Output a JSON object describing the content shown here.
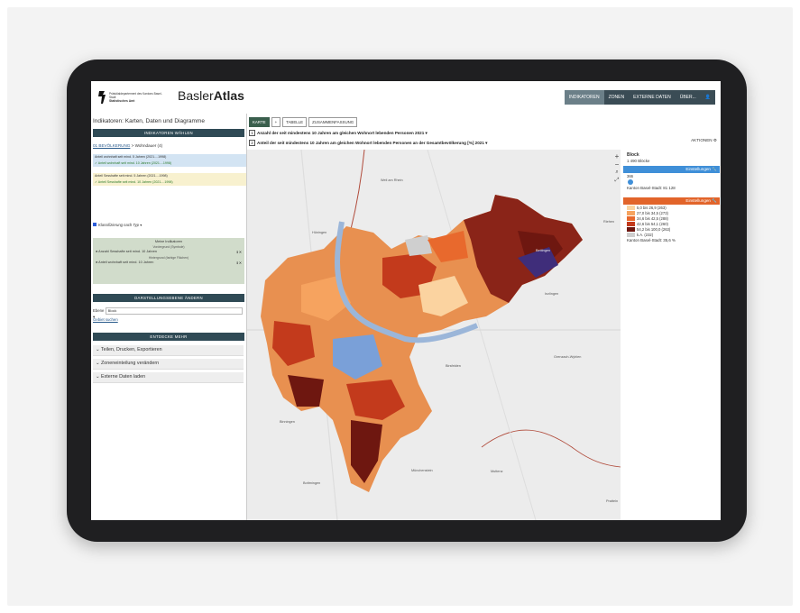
{
  "header": {
    "dept_line1": "Präsidialdepartement des Kantons Basel-Stadt",
    "dept_line2": "Statistisches Amt",
    "brand_light": "Basler",
    "brand_bold": "Atlas",
    "nav": [
      "INDIKATOREN",
      "ZONEN",
      "EXTERNE DATEN",
      "ÜBER...",
      "👤"
    ]
  },
  "left": {
    "title": "Indikatoren: Karten, Daten und Diagramme",
    "bar_indicators": "INDIKATOREN WÄHLEN",
    "crumb_link": "01 BEVÖLKERUNG",
    "crumb_rest": " > Wohndauer (4)",
    "indicators": [
      "Anteil wohnhaft seit mind. 5 Jahren (2021....1998)",
      "✓ Anteil wohnhaft seit mind. 10 Jahren (2021....1998)",
      "Anteil Sesshafte seit mind. 5 Jahren (2021....1998)",
      "✓ Anteil Sesshafte seit mind. 10 Jahren (2021....1998)"
    ],
    "checkbox_label": "Klassifizierung nach Typ",
    "my_indicators": {
      "title": "Meine Indikatoren",
      "sub1": "Vordergrund (Symbole)",
      "row1": "Anzahl Sesshafte seit mind. 10 Jahren",
      "sub2": "Hintergrund (farbige Flächen)",
      "row2": "Anteil wohnhaft seit mind. 10 Jahren"
    },
    "bar_display": "DARSTELLUNGSEBENE ÄNDERN",
    "level_label": "Ebene",
    "level_value": "Block",
    "search_link": "Gebiet suchen",
    "bar_discover": "ENTDECKE MEHR",
    "accordions": [
      "Teilen, Drucken, Exportieren",
      "Zoneneinteilung verändern",
      "Externe Daten laden"
    ]
  },
  "main": {
    "tabs": [
      "KARTE",
      "+",
      "TABELLE",
      "ZUSAMMENFASSUNG"
    ],
    "q1_num": "1",
    "q1": "Anzahl der seit mindestens 10 Jahren am gleichen Wohnort lebenden Personen  2021 ▾",
    "q2_num": "2",
    "q2": "Anteil der seit mindestens 10 Jahren am gleichen Wohnort lebenden Personen an der Gesamtbevölkerung [%]  2021 ▾",
    "aktionen": "AKTIONEN ⚙",
    "places": [
      "Weil am Rhein",
      "Hüningen",
      "Riehen",
      "Birsfelden",
      "Grenzach-Wyhlen",
      "Binningen",
      "Münchenstein",
      "Muttenz",
      "Bottmingen",
      "Pratteln",
      "Bettingen",
      "Inzlingen"
    ]
  },
  "legend": {
    "level": "Block",
    "count": "1 490 Blöcke",
    "settings1": "Einstellungen 🔧",
    "dot_label": "366",
    "total1": "Kanton Basel-Stadt: 81 128",
    "settings2": "Einstellungen 🔧",
    "classes": [
      "5,0 bis 26,9 (263)",
      "27,0 bis 34,5 (273)",
      "34,6 bis 42,5 (288)",
      "42,6 bis 54,1 (260)",
      "54,2 bis 100,0 (263)",
      "k.A. (232)"
    ],
    "class_colors": [
      "#fbd3a0",
      "#f6a35f",
      "#e8692d",
      "#c33a1c",
      "#6e1710",
      "#cfcfcf"
    ],
    "total2": "Kanton Basel-Stadt: 35,6 %"
  },
  "colors": {
    "nav_bg": "#3a4c55",
    "bar_bg": "#2f4a55",
    "legend_blue": "#3f8fd8",
    "legend_orange": "#e2642a"
  }
}
